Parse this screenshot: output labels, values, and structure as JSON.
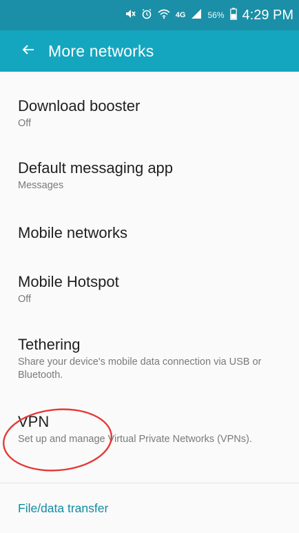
{
  "status_bar": {
    "battery_percent_text": "56%",
    "time": "4:29 PM",
    "icons": [
      "mute-icon",
      "alarm-icon",
      "wifi-icon",
      "lte-icon",
      "signal-icon",
      "battery-icon"
    ],
    "lte_label": "4G",
    "background": "#1a8fa7"
  },
  "app_bar": {
    "title": "More networks",
    "background": "#15a6bf"
  },
  "items": [
    {
      "title": "Download booster",
      "subtitle": "Off"
    },
    {
      "title": "Default messaging app",
      "subtitle": "Messages"
    },
    {
      "title": "Mobile networks"
    },
    {
      "title": "Mobile Hotspot",
      "subtitle": "Off"
    },
    {
      "title": "Tethering",
      "subtitle": "Share your device's mobile data connection via USB or Bluetooth."
    },
    {
      "title": "VPN",
      "subtitle": "Set up and manage Virtual Private Networks (VPNs)."
    }
  ],
  "section": {
    "label": "File/data transfer",
    "color": "#128aa3"
  },
  "annotation": {
    "color": "#e53935"
  }
}
